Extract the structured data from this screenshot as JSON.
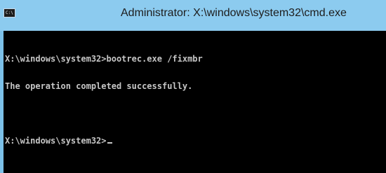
{
  "window": {
    "title": "Administrator: X:\\windows\\system32\\cmd.exe",
    "icon_name": "cmd-icon",
    "icon_text": "C:\\"
  },
  "console": {
    "lines": [
      "X:\\windows\\system32>bootrec.exe /fixmbr",
      "The operation completed successfully.",
      "",
      "X:\\windows\\system32>"
    ],
    "text_color": "#c6c6c6",
    "background_color": "#000000"
  },
  "colors": {
    "titlebar": "#8ccbef",
    "frame": "#7cc0e8"
  }
}
